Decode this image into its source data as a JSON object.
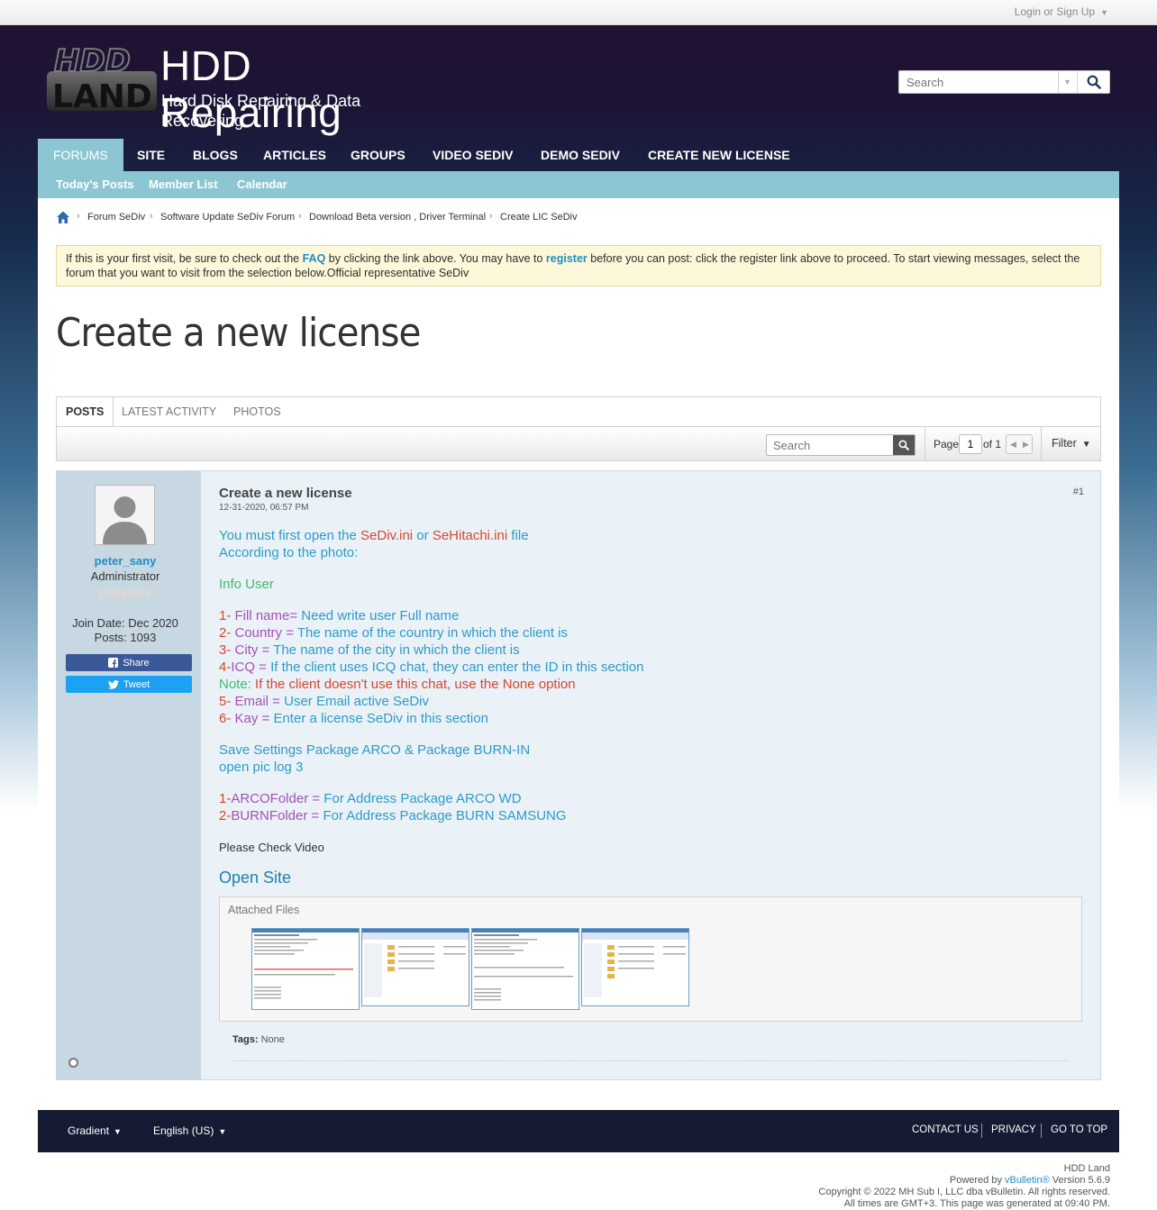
{
  "topbar": {
    "login_label": "Login or Sign Up"
  },
  "header": {
    "logo_mark_top": "HDD",
    "logo_mark_bottom": "LAND",
    "title": "HDD Repairing",
    "subtitle": "Hard Disk Repairing & Data Recovering",
    "search_placeholder": "Search"
  },
  "nav": {
    "items": [
      "FORUMS",
      "SITE",
      "BLOGS",
      "ARTICLES",
      "GROUPS",
      "VIDEO SEDIV",
      "DEMO SEDIV",
      "CREATE NEW LICENSE"
    ],
    "sub_items": [
      "Today's Posts",
      "Member List",
      "Calendar"
    ]
  },
  "breadcrumb": [
    "Forum SeDiv",
    "Software Update SeDiv Forum",
    "Download Beta version , Driver Terminal",
    "Create LIC SeDiv"
  ],
  "notice": {
    "t1": "If this is your first visit, be sure to check out the ",
    "faq": "FAQ",
    "t2": " by clicking the link above. You may have to ",
    "register": "register",
    "t3": " before you can post: click the register link above to proceed. To start viewing messages, select the forum that you want to visit from the selection below.Official representative SeDiv"
  },
  "page_title": "Create a new license",
  "tabs": [
    "POSTS",
    "LATEST ACTIVITY",
    "PHOTOS"
  ],
  "toolbar": {
    "search_placeholder": "Search",
    "page_label": "Page",
    "page_value": "1",
    "of_label": "of 1",
    "filter_label": "Filter"
  },
  "post": {
    "author": "peter_sany",
    "role": "Administrator",
    "join_date": "Join Date: Dec 2020",
    "posts": "Posts: 1093",
    "share_label": "Share",
    "tweet_label": "Tweet",
    "title": "Create a new license",
    "date": "12-31-2020, 06:57 PM",
    "number": "#1",
    "body": {
      "l1a": "You must first open the ",
      "l1b": "SeDiv.ini",
      "l1c": " or ",
      "l1d": "SeHitachi.ini",
      "l1e": " file",
      "l2": "According to the photo:",
      "l3": "Info User",
      "f1n": "1-",
      "f1k": " Fill name=",
      "f1v": " Need write user Full name",
      "f2n": "2-",
      "f2k": " Country =",
      "f2v": " The name of the country in which the client is",
      "f3n": "3-",
      "f3k": " City =",
      "f3v": " The name of the city in which the client is",
      "f4n": "4-",
      "f4k": "ICQ =",
      "f4v": " If the client uses ICQ chat, they can enter the ID in this section",
      "note_k": "Note:",
      "note_v": " If the client doesn't use this chat, use the None option",
      "f5n": "5-",
      "f5k": " Email =",
      "f5v": " User Email active SeDiv",
      "f6n": "6-",
      "f6k": " Kay =",
      "f6v": " Enter a license SeDiv in this section",
      "s1": "Save Settings Package ARCO & Package BURN-IN",
      "s2": "open pic log 3",
      "p1n": "1-",
      "p1k": "ARCOFolder =",
      "p1v": " For Address Package ARCO WD",
      "p2n": "2-",
      "p2k": "BURNFolder =",
      "p2v": " For Address Package BURN SAMSUNG",
      "check": "Please Check Video",
      "open_site": "Open Site"
    },
    "attached_title": "Attached Files",
    "tags_label": "Tags:",
    "tags_value": "None"
  },
  "footer": {
    "style": "Gradient",
    "language": "English (US)",
    "links": [
      "CONTACT US",
      "PRIVACY",
      "GO TO TOP"
    ]
  },
  "copyright": {
    "site": "HDD Land",
    "powered": "Powered by ",
    "vb": "vBulletin®",
    "version": " Version 5.6.9",
    "copy": "Copyright © 2022 MH Sub I, LLC dba vBulletin. All rights reserved.",
    "times": "All times are GMT+3. This page was generated at 09:40 PM."
  },
  "colors": {
    "accent": "#8cc6d3",
    "link": "#1f8ec4",
    "body_blue": "#2d9ac8",
    "body_red": "#d8452f",
    "body_green": "#3bbc6a",
    "body_purple": "#a550b8",
    "footer_bg": "#141b33"
  },
  "icons": [
    "home-icon",
    "search-icon",
    "chevron-right-icon",
    "facebook-icon",
    "twitter-icon",
    "filter-caret-icon"
  ]
}
